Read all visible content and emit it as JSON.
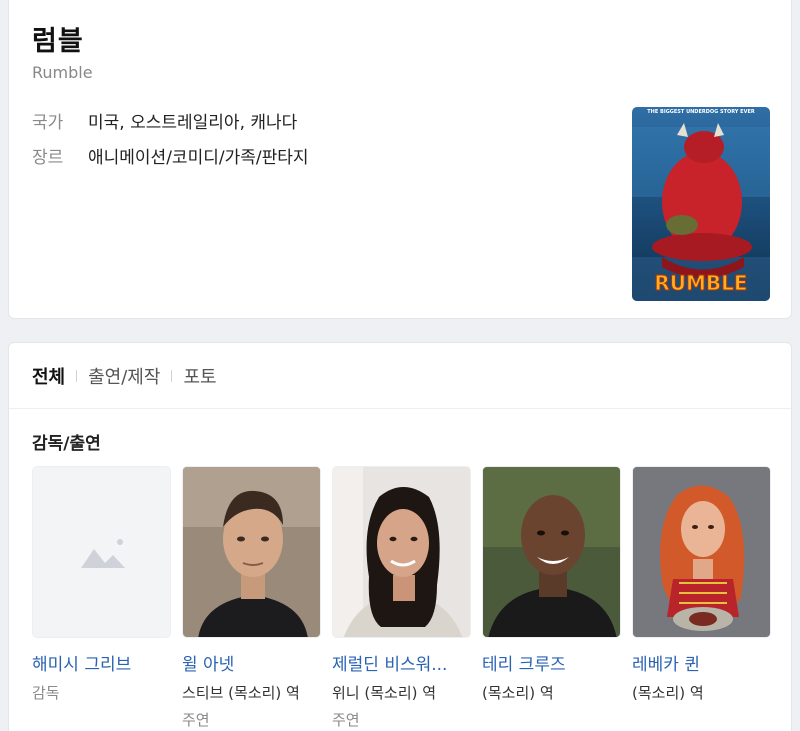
{
  "movie": {
    "title": "럼블",
    "original_title": "Rumble",
    "country_label": "국가",
    "country_value": "미국, 오스트레일리아, 캐나다",
    "genre_label": "장르",
    "genre_value": "애니메이션/코미디/가족/판타지",
    "poster": {
      "tagline": "THE BIGGEST UNDERDOG STORY EVER",
      "logo": "RUMBLE"
    }
  },
  "tabs": [
    "전체",
    "출연/제작",
    "포토"
  ],
  "cast_section_title": "감독/출연",
  "people": [
    {
      "name": "해미시 그리브",
      "role": "",
      "type": "감독"
    },
    {
      "name": "윌 아넷",
      "role": "스티브 (목소리) 역",
      "type": "주연"
    },
    {
      "name": "제럴딘 비스워...",
      "role": "위니 (목소리) 역",
      "type": "주연"
    },
    {
      "name": "테리 크루즈",
      "role": "(목소리) 역",
      "type": ""
    },
    {
      "name": "레베카 퀸",
      "role": "(목소리) 역",
      "type": ""
    }
  ]
}
